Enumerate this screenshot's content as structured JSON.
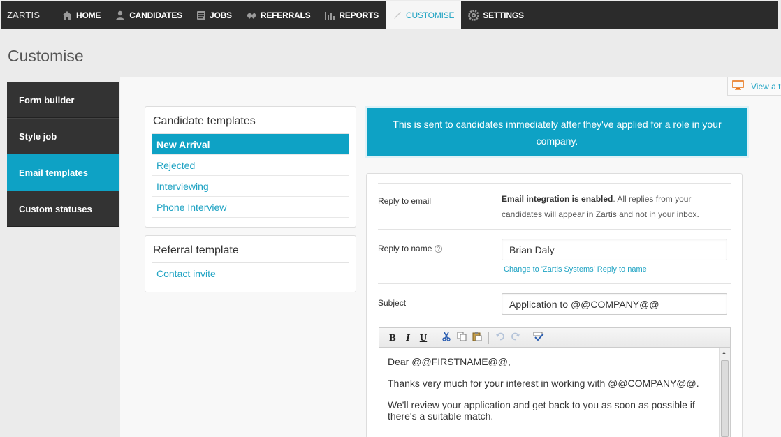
{
  "nav": {
    "brand": "ZARTIS",
    "items": [
      {
        "label": "HOME",
        "icon": "home-icon"
      },
      {
        "label": "CANDIDATES",
        "icon": "candidates-icon"
      },
      {
        "label": "JOBS",
        "icon": "jobs-icon"
      },
      {
        "label": "REFERRALS",
        "icon": "referrals-icon"
      },
      {
        "label": "REPORTS",
        "icon": "reports-icon"
      },
      {
        "label": "CUSTOMISE",
        "icon": "customise-icon",
        "active": true
      },
      {
        "label": "SETTINGS",
        "icon": "settings-icon"
      }
    ]
  },
  "page": {
    "title": "Customise",
    "view_link": "View a t"
  },
  "side_menu": {
    "items": [
      {
        "label": "Form builder"
      },
      {
        "label": "Style job"
      },
      {
        "label": "Email templates",
        "active": true
      },
      {
        "label": "Custom statuses"
      }
    ]
  },
  "candidate_templates": {
    "title": "Candidate templates",
    "items": [
      {
        "label": "New Arrival",
        "active": true
      },
      {
        "label": "Rejected"
      },
      {
        "label": "Interviewing"
      },
      {
        "label": "Phone Interview"
      }
    ]
  },
  "referral_template": {
    "title": "Referral template",
    "items": [
      {
        "label": "Contact invite"
      }
    ]
  },
  "banner": {
    "text": "This is sent to candidates immediately after they've applied for a role in your company."
  },
  "form": {
    "reply_email": {
      "label": "Reply to email",
      "note_bold": "Email integration is enabled",
      "note_rest": ". All replies from your candidates will appear in Zartis and not in your inbox."
    },
    "reply_name": {
      "label": "Reply to name",
      "value": "Brian Daly",
      "change_link": "Change to 'Zartis Systems' Reply to name"
    },
    "subject": {
      "label": "Subject",
      "value": "Application to @@COMPANY@@"
    }
  },
  "editor": {
    "toolbar": {
      "bold": "B",
      "italic": "I",
      "underline": "U"
    },
    "body": {
      "line1": "Dear @@FIRSTNAME@@,",
      "line2": "Thanks very much for your interest in working with @@COMPANY@@.",
      "line3": "We'll review your application and get back to you as soon as possible if there's a suitable match."
    }
  },
  "colors": {
    "accent": "#0ea2c5",
    "nav_bg": "#2b2b2b",
    "link": "#1fa3c3"
  }
}
